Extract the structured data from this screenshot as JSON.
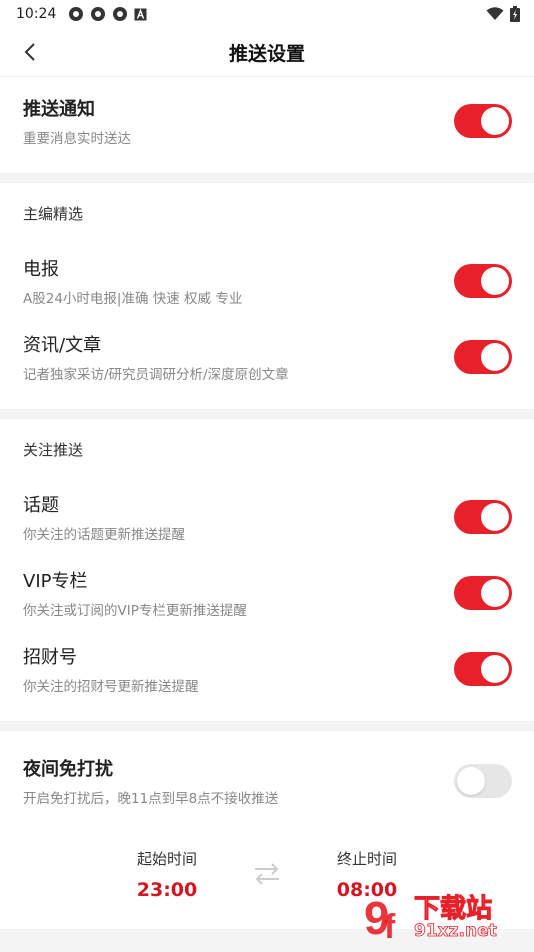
{
  "status": {
    "time": "10:24"
  },
  "nav": {
    "title": "推送设置"
  },
  "push": {
    "title": "推送通知",
    "desc": "重要消息实时送达",
    "on": true
  },
  "editor": {
    "header": "主编精选",
    "items": [
      {
        "title": "电报",
        "desc": "A股24小时电报|准确 快速 权威 专业",
        "on": true
      },
      {
        "title": "资讯/文章",
        "desc": "记者独家采访/研究员调研分析/深度原创文章",
        "on": true
      }
    ]
  },
  "follow": {
    "header": "关注推送",
    "items": [
      {
        "title": "话题",
        "desc": "你关注的话题更新推送提醒",
        "on": true
      },
      {
        "title": "VIP专栏",
        "desc": "你关注或订阅的VIP专栏更新推送提醒",
        "on": true
      },
      {
        "title": "招财号",
        "desc": "你关注的招财号更新推送提醒",
        "on": true
      }
    ]
  },
  "night": {
    "title": "夜间免打扰",
    "desc": "开启免打扰后，晚11点到早8点不接收推送",
    "on": false,
    "start_label": "起始时间",
    "start_value": "23:00",
    "end_label": "终止时间",
    "end_value": "08:00"
  },
  "watermark": {
    "text1": "下载站",
    "text2": "91xz.net"
  },
  "colors": {
    "accent": "#e8202a",
    "time_red": "#d4151f"
  }
}
